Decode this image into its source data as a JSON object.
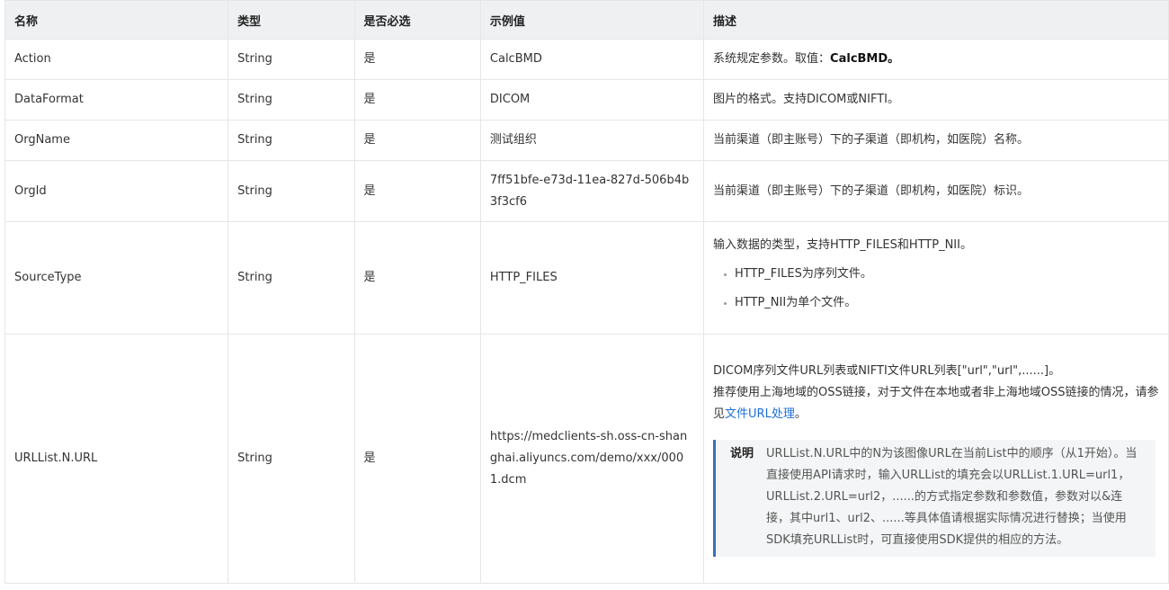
{
  "headers": [
    "名称",
    "类型",
    "是否必选",
    "示例值",
    "描述"
  ],
  "rows": [
    {
      "name": "Action",
      "type": "String",
      "required": "是",
      "example": "CalcBMD",
      "desc_prefix": "系统规定参数。取值：",
      "desc_bold": "CalcBMD",
      "desc_suffix": "。"
    },
    {
      "name": "DataFormat",
      "type": "String",
      "required": "是",
      "example": "DICOM",
      "desc": "图片的格式。支持DICOM或NIFTI。"
    },
    {
      "name": "OrgName",
      "type": "String",
      "required": "是",
      "example": "测试组织",
      "desc": "当前渠道（即主账号）下的子渠道（即机构，如医院）名称。"
    },
    {
      "name": "OrgId",
      "type": "String",
      "required": "是",
      "example": "7ff51bfe-e73d-11ea-827d-506b4b3f3cf6",
      "desc": "当前渠道（即主账号）下的子渠道（即机构，如医院）标识。"
    },
    {
      "name": "SourceType",
      "type": "String",
      "required": "是",
      "example": "HTTP_FILES",
      "desc": "输入数据的类型，支持HTTP_FILES和HTTP_NII。",
      "bullets": [
        "HTTP_FILES为序列文件。",
        "HTTP_NII为单个文件。"
      ]
    },
    {
      "name": "URLList.N.URL",
      "type": "String",
      "required": "是",
      "example": "https://medclients-sh.oss-cn-shanghai.aliyuncs.com/demo/xxx/0001.dcm",
      "desc_line1": "DICOM序列文件URL列表或NIFTI文件URL列表[\"url\",\"url\",......]。",
      "desc_line2": "推荐使用上海地域的OSS链接，对于文件在本地或者非上海地域OSS链接的情况，请参见",
      "desc_link": "文件URL处理",
      "desc_line2_end": "。",
      "note_label": "说明",
      "note_text": "URLList.N.URL中的N为该图像URL在当前List中的顺序（从1开始）。当直接使用API请求时，输入URLList的填充会以URLList.1.URL=url1，URLList.2.URL=url2，......的方式指定参数和参数值，参数对以&连接，其中url1、url2、......等具体值请根据实际情况进行替换；当使用SDK填充URLList时，可直接使用SDK提供的相应的方法。"
    }
  ]
}
